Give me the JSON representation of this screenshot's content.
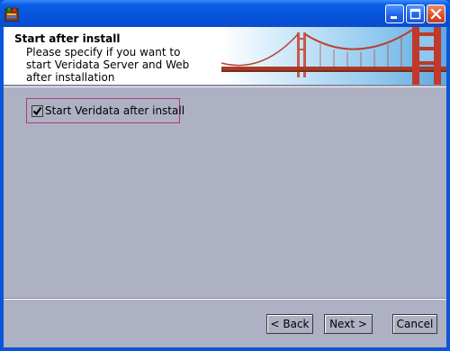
{
  "header": {
    "title": "Start after install",
    "description": "Please specify if you want to start Veridata Server and Web after installation"
  },
  "option": {
    "label": "Start Veridata after install",
    "checked": true
  },
  "buttons": {
    "back": "< Back",
    "next": "Next >",
    "cancel": "Cancel"
  },
  "colors": {
    "titlebar": "#0553da",
    "dialog_background": "#aeb0c3",
    "focus_border": "#b03d72",
    "bridge": "#c0392b"
  },
  "icons": {
    "app": "installer-icon",
    "minimize": "minimize-icon",
    "maximize": "maximize-icon",
    "close": "close-icon",
    "banner": "golden-gate-bridge-image"
  }
}
